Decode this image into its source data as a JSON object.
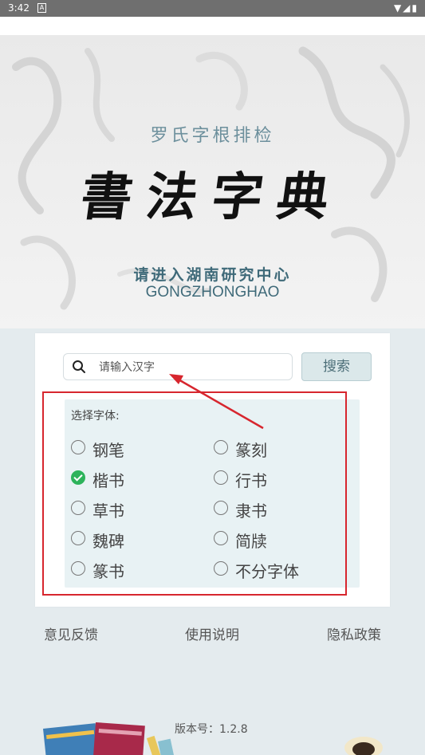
{
  "status_bar": {
    "time": "3:42",
    "sim_label": "A",
    "icons": "▼◢▮"
  },
  "hero": {
    "subtitle": "罗氏字根排检",
    "title": "書法字典",
    "promo_line1": "请进入湖南研究中心",
    "promo_line2": "GONGZHONGHAO"
  },
  "search": {
    "placeholder": "请输入汉字",
    "value": "",
    "button_label": "搜索",
    "icon": "search-icon"
  },
  "font_select": {
    "label": "选择字体:",
    "options": [
      {
        "label": "钢笔",
        "checked": false
      },
      {
        "label": "篆刻",
        "checked": false
      },
      {
        "label": "楷书",
        "checked": true
      },
      {
        "label": "行书",
        "checked": false
      },
      {
        "label": "草书",
        "checked": false
      },
      {
        "label": "隶书",
        "checked": false
      },
      {
        "label": "魏碑",
        "checked": false
      },
      {
        "label": "简牍",
        "checked": false
      },
      {
        "label": "篆书",
        "checked": false
      },
      {
        "label": "不分字体",
        "checked": false
      }
    ]
  },
  "footer_links": {
    "feedback": "意见反馈",
    "instructions": "使用说明",
    "privacy": "隐私政策"
  },
  "version": "版本号：1.2.8",
  "colors": {
    "accent": "#2db35b",
    "annotation_red": "#d7262e",
    "teal_text": "#3f6a79"
  }
}
